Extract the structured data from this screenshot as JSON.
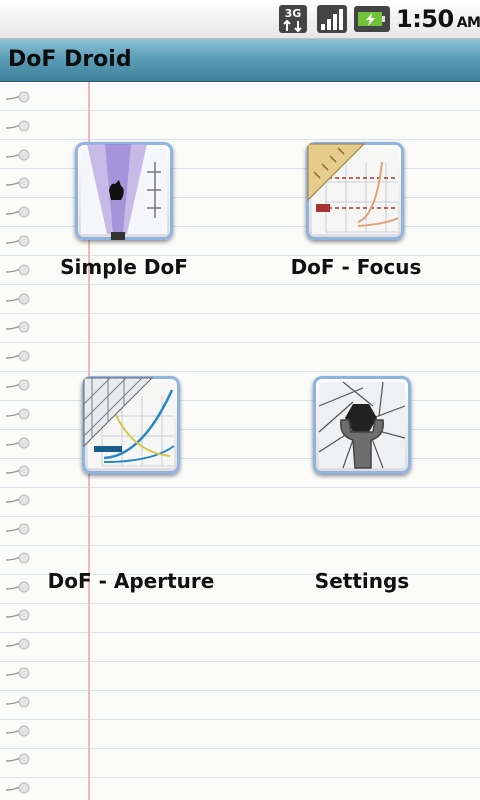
{
  "status_bar": {
    "network": "3G",
    "time": "1:50",
    "ampm": "AM"
  },
  "title_bar": {
    "title": "DoF Droid"
  },
  "menu": {
    "items": [
      {
        "label": "Simple DoF",
        "icon": "simple-dof-icon"
      },
      {
        "label": "DoF - Focus",
        "icon": "dof-focus-icon"
      },
      {
        "label": "DoF - Aperture",
        "icon": "dof-aperture-icon"
      },
      {
        "label": "Settings",
        "icon": "settings-wrench-icon"
      }
    ]
  },
  "colors": {
    "title_bar": "#5d9eb8",
    "icon_border": "#8fb4e2",
    "ruled_line": "#d8e6ea",
    "margin_line": "#f0b9b9",
    "battery_charge": "#6fc23a"
  }
}
